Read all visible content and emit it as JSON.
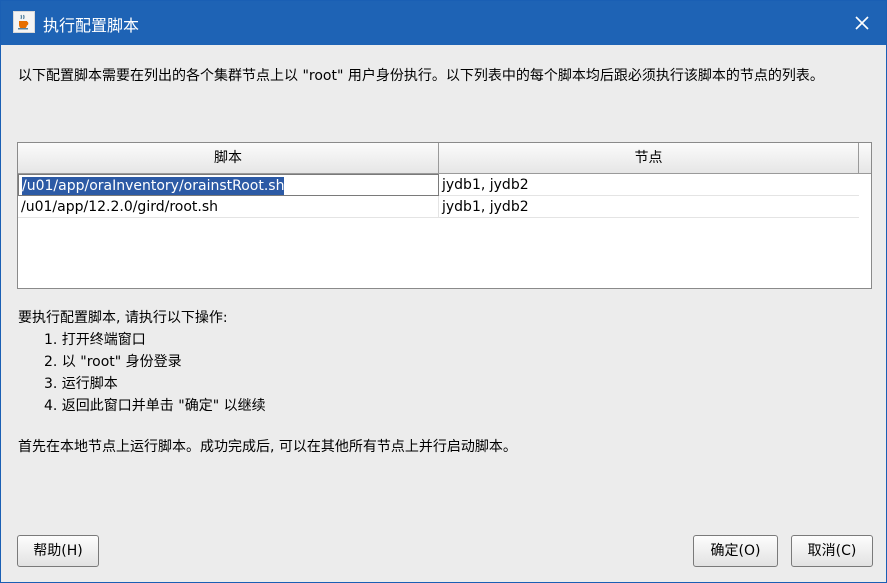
{
  "window": {
    "title": "执行配置脚本",
    "icon": "java-cup-icon"
  },
  "intro_text": "以下配置脚本需要在列出的各个集群节点上以 \"root\" 用户身份执行。以下列表中的每个脚本均后跟必须执行该脚本的节点的列表。",
  "table": {
    "headers": [
      "脚本",
      "节点"
    ],
    "rows": [
      {
        "script": "/u01/app/oraInventory/orainstRoot.sh",
        "nodes": "jydb1, jydb2"
      },
      {
        "script": "/u01/app/12.2.0/gird/root.sh",
        "nodes": "jydb1, jydb2"
      }
    ]
  },
  "instructions": {
    "heading": "要执行配置脚本, 请执行以下操作:",
    "steps": [
      "1. 打开终端窗口",
      "2. 以 \"root\" 身份登录",
      "3. 运行脚本",
      "4. 返回此窗口并单击 \"确定\" 以继续"
    ]
  },
  "note": "首先在本地节点上运行脚本。成功完成后, 可以在其他所有节点上并行启动脚本。",
  "buttons": {
    "help": "帮助(H)",
    "ok": "确定(O)",
    "cancel": "取消(C)"
  },
  "colors": {
    "titlebar": "#1e63b5",
    "selection": "#2c5aa5",
    "background": "#ececec"
  }
}
